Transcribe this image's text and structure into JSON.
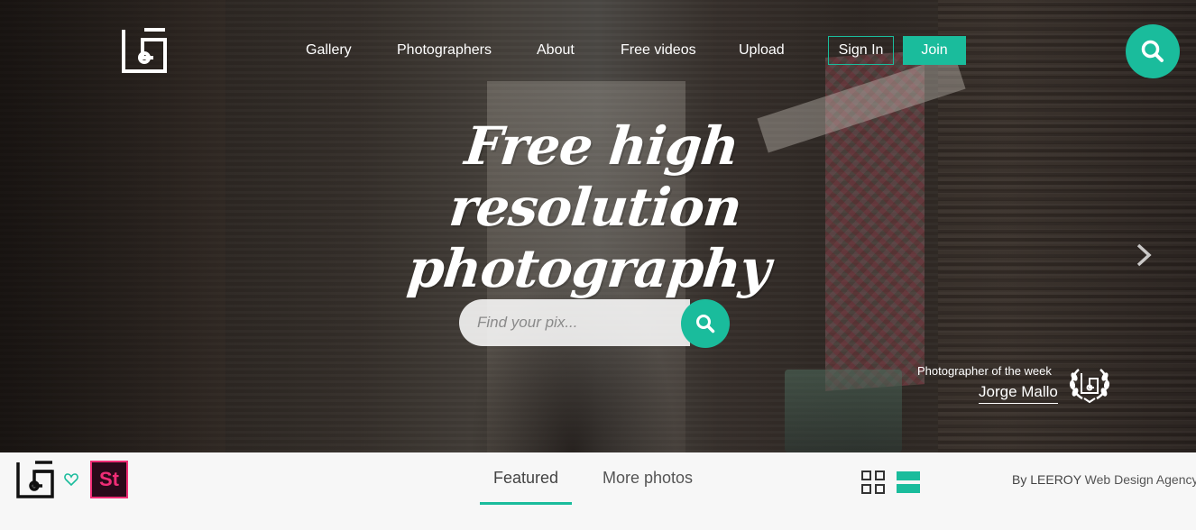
{
  "brand": {
    "accent": "#1abc9c",
    "logo_icon": "lifeofpix-logo-icon"
  },
  "nav": {
    "items": [
      "Gallery",
      "Photographers",
      "About",
      "Free videos",
      "Upload"
    ],
    "signin_label": "Sign In",
    "join_label": "Join",
    "search_icon": "search-icon"
  },
  "hero": {
    "headline_line1": "Free high resolution",
    "headline_line2": "photography",
    "search_placeholder": "Find your pix...",
    "next_icon": "chevron-right-icon",
    "photographer_of_week": {
      "label": "Photographer of the week",
      "name": "Jorge Mallo"
    }
  },
  "bottombar": {
    "favorite_icon": "heart-icon",
    "stock_badge": "St",
    "tabs": [
      {
        "label": "Featured",
        "active": true
      },
      {
        "label": "More photos",
        "active": false
      }
    ],
    "view_icons": [
      "grid-view-icon",
      "list-view-icon"
    ],
    "credit_prefix": "By LEEROY",
    "credit_agency": "Web Design Agency"
  }
}
